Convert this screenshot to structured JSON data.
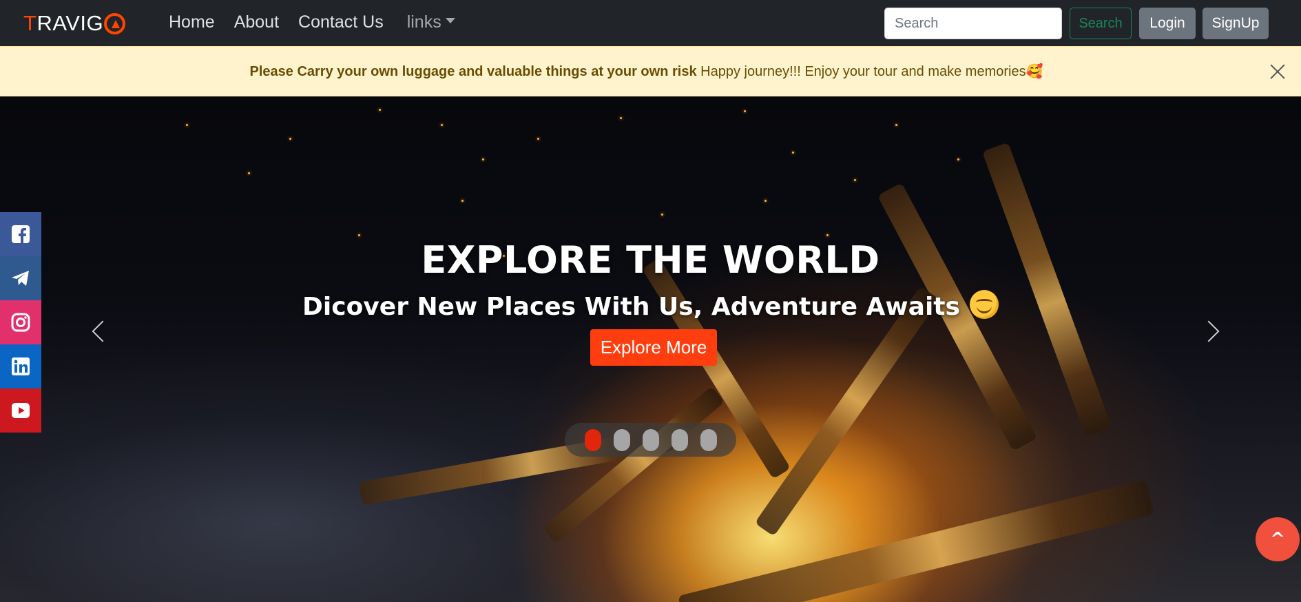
{
  "navbar": {
    "brand_first": "T",
    "brand_rest": "RAVIG",
    "links": [
      {
        "label": "Home"
      },
      {
        "label": "About"
      },
      {
        "label": "Contact Us"
      }
    ],
    "dropdown_label": "links",
    "search_placeholder": "Search",
    "search_button": "Search",
    "login_button": "Login",
    "signup_button": "SignUp"
  },
  "alert": {
    "strong_text": "Please Carry your own luggage and valuable things at your own risk",
    "text": " Happy journey!!! Enjoy your tour and make memories🥰"
  },
  "hero": {
    "title": "EXPLORE THE WORLD",
    "subtitle": "Dicover New Places With Us, Adventure Awaits",
    "cta": "Explore More",
    "slides_count": 5,
    "active_slide": 1
  },
  "social": [
    "facebook-icon",
    "telegram-icon",
    "instagram-icon",
    "linkedin-icon",
    "youtube-icon"
  ],
  "back_to_top": "^",
  "colors": {
    "accent": "#ff3e0f",
    "navbar": "#212529",
    "alert_bg": "#fff3cd",
    "search_green": "#198754"
  }
}
